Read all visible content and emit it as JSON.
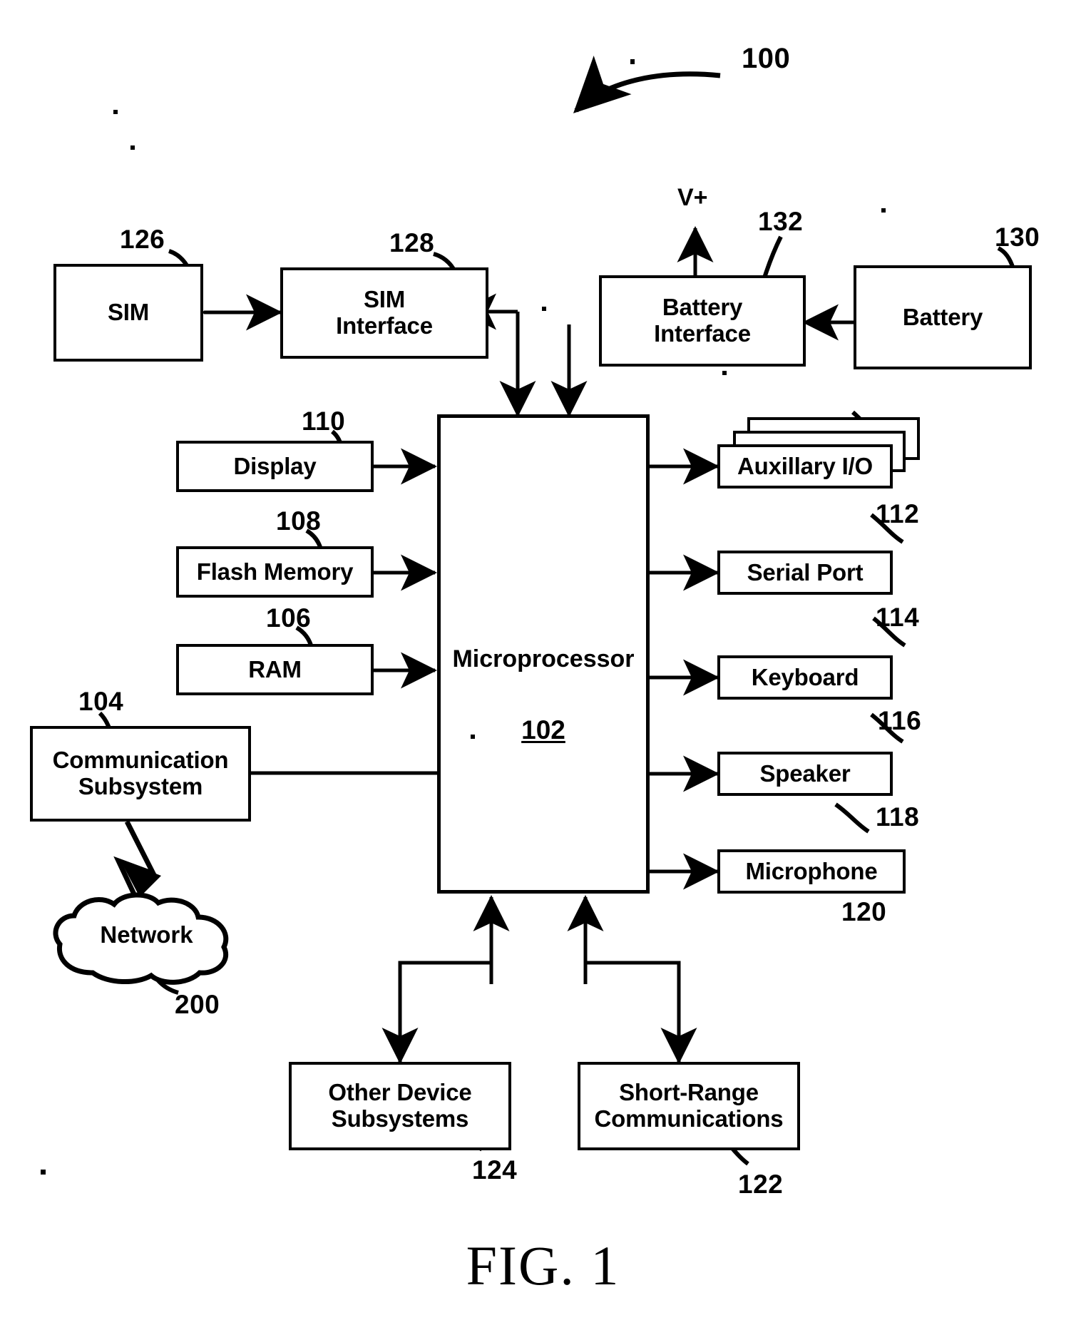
{
  "figure": {
    "caption": "FIG. 1",
    "system_ref": "100",
    "power_rail_label": "V+"
  },
  "nodes": {
    "sim": {
      "label": "SIM",
      "ref": "126"
    },
    "sim_interface": {
      "label": "SIM\nInterface",
      "ref": "128"
    },
    "battery_interface": {
      "label": "Battery\nInterface",
      "ref": "132"
    },
    "battery": {
      "label": "Battery",
      "ref": "130"
    },
    "display": {
      "label": "Display",
      "ref": "110"
    },
    "flash_memory": {
      "label": "Flash Memory",
      "ref": "108"
    },
    "ram": {
      "label": "RAM",
      "ref": "106"
    },
    "communication_subsystem": {
      "label": "Communication\nSubsystem",
      "ref": "104"
    },
    "network": {
      "label": "Network",
      "ref": "200"
    },
    "microprocessor": {
      "label": "Microprocessor",
      "ref": "102"
    },
    "auxiliary_io": {
      "label": "Auxillary I/O",
      "ref": "112"
    },
    "serial_port": {
      "label": "Serial Port",
      "ref": "114"
    },
    "keyboard": {
      "label": "Keyboard",
      "ref": "116"
    },
    "speaker": {
      "label": "Speaker",
      "ref": "118"
    },
    "microphone": {
      "label": "Microphone",
      "ref": "120"
    },
    "other_device_subsystems": {
      "label": "Other Device\nSubsystems",
      "ref": "124"
    },
    "short_range_communications": {
      "label": "Short-Range\nCommunications",
      "ref": "122"
    }
  },
  "colors": {
    "ink": "#000000",
    "paper": "#ffffff"
  }
}
